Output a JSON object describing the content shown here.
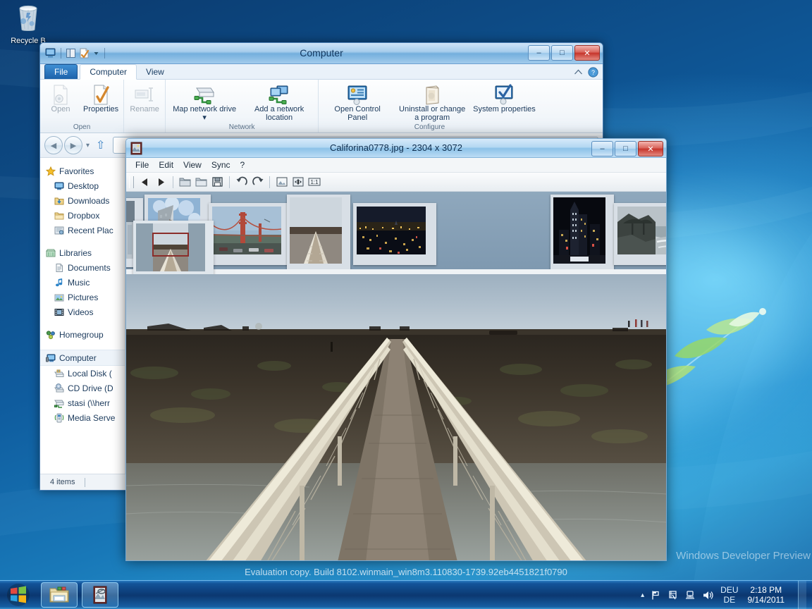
{
  "desktop": {
    "recycle_bin": {
      "label": "Recycle B",
      "icon": "recycle-bin-icon"
    },
    "watermark_line1": "Windows Developer Preview",
    "watermark_line2": "Evaluation copy. Build 8102.winmain_win8m3.110830-1739.92eb4451821f0790"
  },
  "explorer": {
    "title": "Computer",
    "quick_access": [
      "computer-icon",
      "folder-pane-icon",
      "properties-icon",
      "chevron-down-icon"
    ],
    "caption": {
      "minimize": "–",
      "maximize": "□",
      "close": "✕"
    },
    "tabs": [
      {
        "label": "File",
        "kind": "file"
      },
      {
        "label": "Computer",
        "kind": "active"
      },
      {
        "label": "View",
        "kind": "normal"
      }
    ],
    "help_icons": [
      "ribbon-collapse-icon",
      "help-icon"
    ],
    "ribbon_groups": [
      {
        "label": "Open",
        "buttons": [
          {
            "label": "Open",
            "icon": "open-file-icon",
            "disabled": true
          },
          {
            "label": "Properties",
            "icon": "properties-icon",
            "disabled": false
          }
        ]
      },
      {
        "label": "",
        "buttons": [
          {
            "label": "Rename",
            "icon": "rename-icon",
            "disabled": true
          }
        ]
      },
      {
        "label": "Network",
        "buttons": [
          {
            "label": "Map network drive ▾",
            "icon": "map-network-drive-icon",
            "disabled": false
          },
          {
            "label": "Add a network location",
            "icon": "add-network-location-icon",
            "disabled": false
          }
        ]
      },
      {
        "label": "Configure",
        "buttons": [
          {
            "label": "Open Control Panel",
            "icon": "control-panel-icon",
            "disabled": false
          },
          {
            "label": "Uninstall or change a program",
            "icon": "uninstall-program-icon",
            "disabled": false
          },
          {
            "label": "System properties",
            "icon": "system-properties-icon",
            "disabled": false
          }
        ]
      }
    ],
    "navbar": {
      "back": "◀",
      "forward": "▶",
      "recent_chevron": "▾",
      "up": "⇧",
      "address_value": ""
    },
    "sidebar": [
      {
        "label": "Favorites",
        "icon": "favorites-star-icon",
        "level": 0
      },
      {
        "label": "Desktop",
        "icon": "desktop-icon",
        "level": 1
      },
      {
        "label": "Downloads",
        "icon": "downloads-icon",
        "level": 1
      },
      {
        "label": "Dropbox",
        "icon": "folder-icon",
        "level": 1
      },
      {
        "label": "Recent Plac",
        "icon": "recent-places-icon",
        "level": 1
      },
      {
        "label": "__GAP__",
        "icon": "",
        "level": 0
      },
      {
        "label": "Libraries",
        "icon": "libraries-icon",
        "level": 0
      },
      {
        "label": "Documents",
        "icon": "documents-icon",
        "level": 1
      },
      {
        "label": "Music",
        "icon": "music-icon",
        "level": 1
      },
      {
        "label": "Pictures",
        "icon": "pictures-icon",
        "level": 1
      },
      {
        "label": "Videos",
        "icon": "videos-icon",
        "level": 1
      },
      {
        "label": "__GAP__",
        "icon": "",
        "level": 0
      },
      {
        "label": "Homegroup",
        "icon": "homegroup-icon",
        "level": 0
      },
      {
        "label": "__GAP__",
        "icon": "",
        "level": 0
      },
      {
        "label": "Computer",
        "icon": "computer-icon",
        "level": 0,
        "selected": true
      },
      {
        "label": "Local Disk (",
        "icon": "local-disk-icon",
        "level": 1
      },
      {
        "label": "CD Drive (D",
        "icon": "cd-drive-icon",
        "level": 1
      },
      {
        "label": "stasi (\\\\herr",
        "icon": "network-drive-icon",
        "level": 1
      },
      {
        "label": "Media Serve",
        "icon": "media-server-icon",
        "level": 1
      }
    ],
    "status": "4 items"
  },
  "viewer": {
    "title": "Califorina0778.jpg - 2304 x 3072",
    "window_icon": "image-viewer-icon",
    "caption": {
      "minimize": "–",
      "maximize": "□",
      "close": "✕"
    },
    "menu": [
      "File",
      "Edit",
      "View",
      "Sync",
      "?"
    ],
    "toolbar": [
      {
        "name": "previous-image-button",
        "glyph": "◀"
      },
      {
        "name": "next-image-button",
        "glyph": "▶"
      },
      {
        "name": "separator",
        "glyph": ""
      },
      {
        "name": "open-folder-button",
        "glyph": "folder"
      },
      {
        "name": "open-folder-alt-button",
        "glyph": "folder"
      },
      {
        "name": "save-button",
        "glyph": "save"
      },
      {
        "name": "separator",
        "glyph": ""
      },
      {
        "name": "rotate-left-button",
        "glyph": "↺"
      },
      {
        "name": "rotate-right-button",
        "glyph": "↻"
      },
      {
        "name": "separator",
        "glyph": ""
      },
      {
        "name": "thumbnail-view-button",
        "glyph": "image"
      },
      {
        "name": "fit-to-window-button",
        "glyph": "fit"
      },
      {
        "name": "actual-size-button",
        "glyph": "1:1"
      }
    ],
    "thumbnails": [
      {
        "name": "thumb-partial-left",
        "caption": ""
      },
      {
        "name": "thumb-skyscraper",
        "caption": ""
      },
      {
        "name": "thumb-golden-gate-bridge",
        "caption": ""
      },
      {
        "name": "thumb-boardwalk",
        "caption": ""
      },
      {
        "name": "thumb-city-night",
        "caption": ""
      },
      {
        "name": "thumb-tower-night",
        "caption": ""
      },
      {
        "name": "thumb-lone-cypress",
        "caption": ""
      },
      {
        "name": "thumb-ferris-wheel",
        "caption": ""
      },
      {
        "name": "thumb-partial-right",
        "caption": ""
      }
    ],
    "navigator": {
      "name": "navigator-pane",
      "viewport_color": "#8b2d2a"
    }
  },
  "taskbar": {
    "start_label": "Start",
    "buttons": [
      {
        "name": "taskbar-explorer-button",
        "icon": "folder-explorer-icon"
      },
      {
        "name": "taskbar-image-viewer-button",
        "icon": "image-viewer-icon"
      }
    ],
    "tray": {
      "show_hidden": "▴",
      "icons": [
        "flag-icon",
        "action-center-icon",
        "network-icon",
        "volume-icon"
      ],
      "language_line1": "DEU",
      "language_line2": "DE",
      "time": "2:18 PM",
      "date": "9/14/2011"
    }
  },
  "colors": {
    "accent": "#1c62aa",
    "close_red": "#c6352c",
    "desktop_blue": "#0f5c9e",
    "viewer_canvas": "#9fb2c2"
  }
}
